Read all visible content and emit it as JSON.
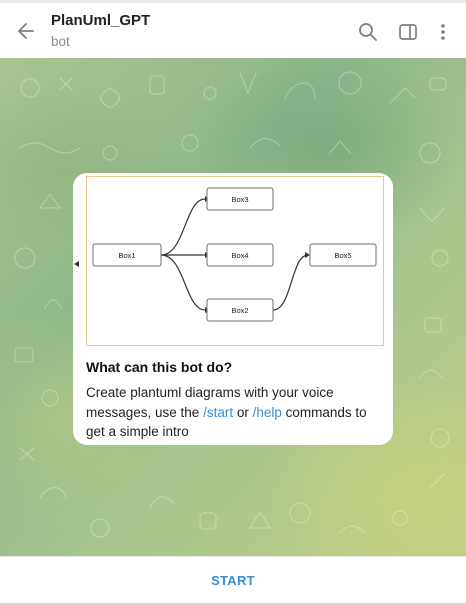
{
  "header": {
    "title": "PlanUml_GPT",
    "subtitle": "bot",
    "back_icon": "arrow-left-icon",
    "search_icon": "search-icon",
    "sidebar_icon": "sidebar-toggle-icon",
    "menu_icon": "more-vertical-icon"
  },
  "intro_card": {
    "diagram": {
      "boxes": [
        "Box1",
        "Box3",
        "Box4",
        "Box2",
        "Box5"
      ]
    },
    "heading": "What can this bot do?",
    "body_before": "Create plantuml diagrams with your voice messages, use the ",
    "start_cmd": "/start",
    "middle": " or ",
    "help_cmd": "/help",
    "body_after": " commands to get a simple intro"
  },
  "footer": {
    "start_label": "START"
  },
  "colors": {
    "accent": "#3a8ed2",
    "diagram_border": "#e8c98f",
    "chat_bg": "#a9c48f"
  }
}
